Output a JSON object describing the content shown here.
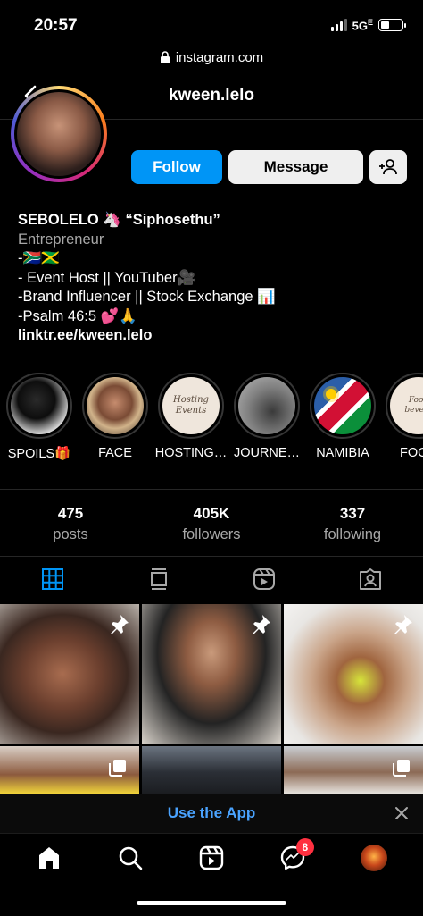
{
  "status": {
    "time": "20:57",
    "network": "5G",
    "network_suffix": "E"
  },
  "browser": {
    "url": "instagram.com"
  },
  "header": {
    "username": "kween.lelo"
  },
  "profile": {
    "buttons": {
      "follow": "Follow",
      "message": "Message"
    },
    "bio": {
      "name": "SEBOLELO 🦄 “Siphosethu”",
      "category": "Entrepreneur",
      "lines": [
        "-🇿🇦🇯🇲",
        "- Event Host || YouTuber🎥",
        "-Brand Influencer || Stock Exchange 📊",
        "-Psalm 46:5 💕🙏"
      ],
      "link": "linktr.ee/kween.lelo"
    }
  },
  "highlights": [
    {
      "label": "SPOILS🎁",
      "icon": "balloons-photo"
    },
    {
      "label": "FACE",
      "icon": "portrait-photo"
    },
    {
      "label": "HOSTING…",
      "icon": "hosting-events-card",
      "card_text": "Hosting Events"
    },
    {
      "label": "JOURNE…",
      "icon": "gray-photo"
    },
    {
      "label": "NAMIBIA",
      "icon": "namibia-flag"
    },
    {
      "label": "FOOD",
      "icon": "food-card",
      "card_text": "Food bevera"
    }
  ],
  "stats": [
    {
      "value": "475",
      "label": "posts"
    },
    {
      "value": "405K",
      "label": "followers"
    },
    {
      "value": "337",
      "label": "following"
    }
  ],
  "tabs": [
    {
      "icon": "grid-icon",
      "active": true
    },
    {
      "icon": "feed-icon",
      "active": false
    },
    {
      "icon": "reels-icon",
      "active": false
    },
    {
      "icon": "tagged-icon",
      "active": false
    }
  ],
  "posts": [
    {
      "pinned": true,
      "multi": false
    },
    {
      "pinned": true,
      "multi": false
    },
    {
      "pinned": true,
      "multi": false
    },
    {
      "pinned": false,
      "multi": true
    },
    {
      "pinned": false,
      "multi": false
    },
    {
      "pinned": false,
      "multi": true
    }
  ],
  "banner": {
    "text": "Use the App"
  },
  "bottom_nav": {
    "messages_badge": "8"
  },
  "colors": {
    "accent": "#0095f6",
    "link": "#4aa3ff",
    "badge": "#ff3040"
  }
}
